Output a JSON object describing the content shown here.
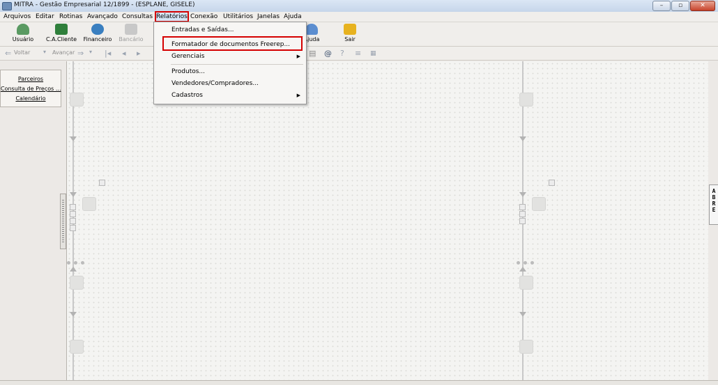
{
  "window": {
    "title": "MITRA - Gestão Empresarial 12/1899 -  (ESPLANE, GISELE)",
    "minimize": "–",
    "maximize": "▫",
    "close": "✕"
  },
  "menu": [
    {
      "label": "Arquivos"
    },
    {
      "label": "Editar"
    },
    {
      "label": "Rotinas"
    },
    {
      "label": "Avançado"
    },
    {
      "label": "Consultas"
    },
    {
      "label": "Relatórios",
      "active": true
    },
    {
      "label": "Conexão"
    },
    {
      "label": "Utilitários"
    },
    {
      "label": "Janelas"
    },
    {
      "label": "Ajuda"
    }
  ],
  "toolbar": [
    {
      "label": "Usuário",
      "icon": "user-icon",
      "color": "#5a9a62"
    },
    {
      "label": "C.A.Cliente",
      "icon": "briefcase-icon",
      "color": "#2f7f3b"
    },
    {
      "label": "Financeiro",
      "icon": "money-icon",
      "color": "#3a7fc0"
    },
    {
      "label": "Bancário",
      "icon": "bank-icon",
      "color": "#b4b4b4",
      "disabled": true
    },
    {
      "label": "Ajuda",
      "icon": "help-icon",
      "color": "#5c8ed0"
    },
    {
      "label": "Sair",
      "icon": "exit-icon",
      "color": "#e7b21f"
    }
  ],
  "nav": {
    "back": "Voltar",
    "forward": "Avançar"
  },
  "sidebar": {
    "items": [
      {
        "label": "Parceiros"
      },
      {
        "label": "Consulta de Preços ..."
      },
      {
        "label": "Calendário"
      }
    ]
  },
  "dropdown": {
    "items": [
      {
        "label": "Entradas e Saídas..."
      },
      {
        "label": "Formatador de documentos Freerep...",
        "highlighted": true
      },
      {
        "label": "Gerenciais",
        "submenu": true
      },
      {
        "label": "Produtos..."
      },
      {
        "label": "Vendedores/Compradores..."
      },
      {
        "label": "Cadastros",
        "submenu": true
      }
    ]
  },
  "right_tab": {
    "label": "ABRE",
    "letters": [
      "A",
      "B",
      "R",
      "E"
    ]
  },
  "colors": {
    "highlight": "#d50000",
    "title_bg": "#c6d6ea"
  }
}
